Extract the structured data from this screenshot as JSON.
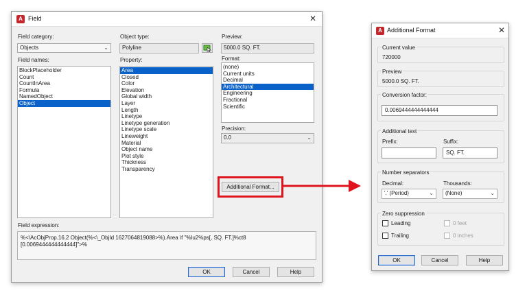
{
  "field_dialog": {
    "title": "Field",
    "close_label": "✕",
    "field_category_label": "Field category:",
    "field_category_value": "Objects",
    "field_names_label": "Field names:",
    "field_names": [
      "BlockPlaceholder",
      "Count",
      "CountInArea",
      "Formula",
      "NamedObject",
      "Object"
    ],
    "field_names_selected": "Object",
    "object_type_label": "Object type:",
    "object_type_value": "Polyline",
    "property_label": "Property:",
    "properties": [
      "Area",
      "Closed",
      "Color",
      "Elevation",
      "Global width",
      "Layer",
      "Length",
      "Linetype",
      "Linetype generation",
      "Linetype scale",
      "Lineweight",
      "Material",
      "Object name",
      "Plot style",
      "Thickness",
      "Transparency"
    ],
    "properties_selected": "Area",
    "preview_label": "Preview:",
    "preview_value": "5000.0 SQ. FT.",
    "format_label": "Format:",
    "formats": [
      "(none)",
      "Current units",
      "Decimal",
      "Architectural",
      "Engineering",
      "Fractional",
      "Scientific"
    ],
    "formats_selected": "Architectural",
    "precision_label": "Precision:",
    "precision_value": "0.0",
    "additional_format_button": "Additional Format...",
    "field_expression_label": "Field expression:",
    "field_expression_line1": "%<\\AcObjProp.16.2 Object(%<\\_ObjId 1627064819088>%).Area \\f \"%lu2%ps[, SQ. FT.]%ct8",
    "field_expression_line2": "[0.0069444444444444]\">%",
    "ok_button": "OK",
    "cancel_button": "Cancel",
    "help_button": "Help"
  },
  "additional_format_dialog": {
    "title": "Additional Format",
    "close_label": "✕",
    "current_value_label": "Current value",
    "current_value": "720000",
    "preview_label": "Preview",
    "preview_value": "5000.0 SQ. FT.",
    "conversion_factor_label": "Conversion factor:",
    "conversion_factor_value": "0.0069444444444444",
    "additional_text_label": "Additional text",
    "prefix_label": "Prefix:",
    "prefix_value": "",
    "suffix_label": "Suffix:",
    "suffix_value": "SQ. FT.",
    "number_separators_label": "Number separators",
    "decimal_label": "Decimal:",
    "decimal_value": "'.' (Period)",
    "thousands_label": "Thousands:",
    "thousands_value": "(None)",
    "zero_suppression_label": "Zero suppression",
    "leading_label": "Leading",
    "trailing_label": "Trailing",
    "zero_feet_label": "0 feet",
    "zero_inches_label": "0 inches",
    "ok_button": "OK",
    "cancel_button": "Cancel",
    "help_button": "Help"
  },
  "annotation": {
    "highlight_color": "#e0141e",
    "selection_color": "#0a61c9"
  }
}
